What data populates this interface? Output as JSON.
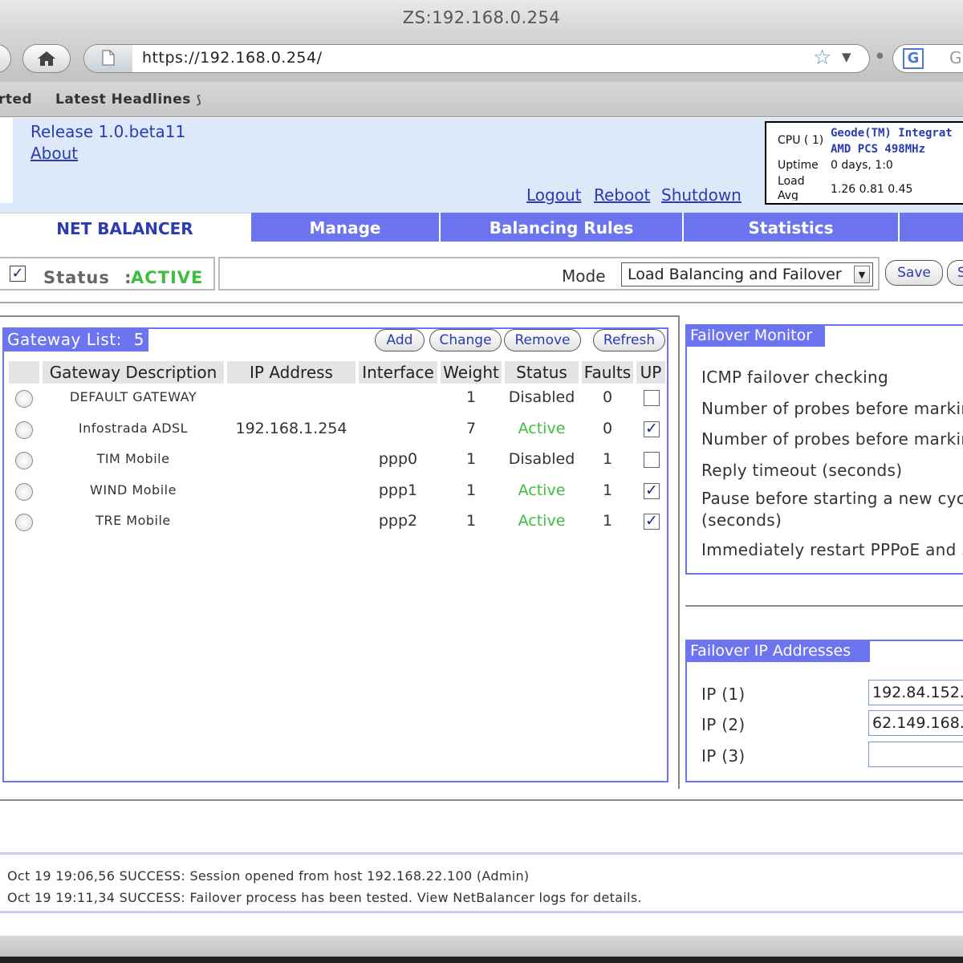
{
  "window": {
    "title": "ZS:192.168.0.254"
  },
  "browser": {
    "url": "https://192.168.0.254/",
    "search_placeholder": "G",
    "search_engine_letter": "G",
    "bookmarks": [
      "rted",
      "Latest Headlines"
    ]
  },
  "header": {
    "release": "Release 1.0.beta11",
    "about": "About",
    "links": {
      "logout": "Logout",
      "reboot": "Reboot",
      "shutdown": "Shutdown"
    },
    "sysinfo": {
      "cpu_label": "CPU ( 1)",
      "cpu_value_1": "Geode(TM) Integrat",
      "cpu_value_2": "AMD PCS 498MHz",
      "uptime_label": "Uptime",
      "uptime_value": "0 days, 1:0",
      "load_label_1": "Load",
      "load_label_2": "Avg",
      "load_value": "1.26 0.81 0.45"
    }
  },
  "nav": {
    "tabs": [
      "NET BALANCER",
      "Manage",
      "Balancing Rules",
      "Statistics"
    ]
  },
  "status": {
    "label": "Status",
    "separator": ":",
    "value": "ACTIVE",
    "mode_label": "Mode",
    "mode_value": "Load Balancing and Failover",
    "save": "Save",
    "next_button": "S"
  },
  "gateway": {
    "title": "Gateway List:",
    "count": "5",
    "buttons": {
      "add": "Add",
      "change": "Change",
      "remove": "Remove",
      "refresh": "Refresh"
    },
    "columns": [
      "Gateway Description",
      "IP Address",
      "Interface",
      "Weight",
      "Status",
      "Faults",
      "UP"
    ],
    "rows": [
      {
        "desc": "DEFAULT GATEWAY",
        "ip": "",
        "iface": "",
        "weight": "1",
        "status": "Disabled",
        "faults": "0",
        "up": ""
      },
      {
        "desc": "Infostrada ADSL",
        "ip": "192.168.1.254",
        "iface": "",
        "weight": "7",
        "status": "Active",
        "faults": "0",
        "up": "✓"
      },
      {
        "desc": "TIM Mobile",
        "ip": "",
        "iface": "ppp0",
        "weight": "1",
        "status": "Disabled",
        "faults": "1",
        "up": ""
      },
      {
        "desc": "WIND Mobile",
        "ip": "",
        "iface": "ppp1",
        "weight": "1",
        "status": "Active",
        "faults": "1",
        "up": "✓"
      },
      {
        "desc": "TRE Mobile",
        "ip": "",
        "iface": "ppp2",
        "weight": "1",
        "status": "Active",
        "faults": "1",
        "up": "✓"
      }
    ]
  },
  "failover_monitor": {
    "title": "Failover Monitor",
    "lines": [
      "ICMP failover checking",
      "Number of probes before markin",
      "Number of probes before markin",
      "Reply timeout (seconds)",
      "Pause before starting a new cycl",
      "(seconds)",
      "Immediately restart PPPoE and 3"
    ]
  },
  "failover_ips": {
    "title": "Failover IP Addresses",
    "items": [
      {
        "label": "IP (1)",
        "value": "192.84.152."
      },
      {
        "label": "IP (2)",
        "value": "62.149.168."
      },
      {
        "label": "IP (3)",
        "value": ""
      }
    ]
  },
  "log": [
    "Oct 19 19:06,56 SUCCESS: Session opened from host 192.168.22.100 (Admin)",
    "Oct 19 19:11,34 SUCCESS: Failover process has been tested. View NetBalancer logs for details."
  ],
  "colors": {
    "accent": "#6c74f0",
    "active": "#3fbd3f",
    "link": "#2b3bb0"
  }
}
